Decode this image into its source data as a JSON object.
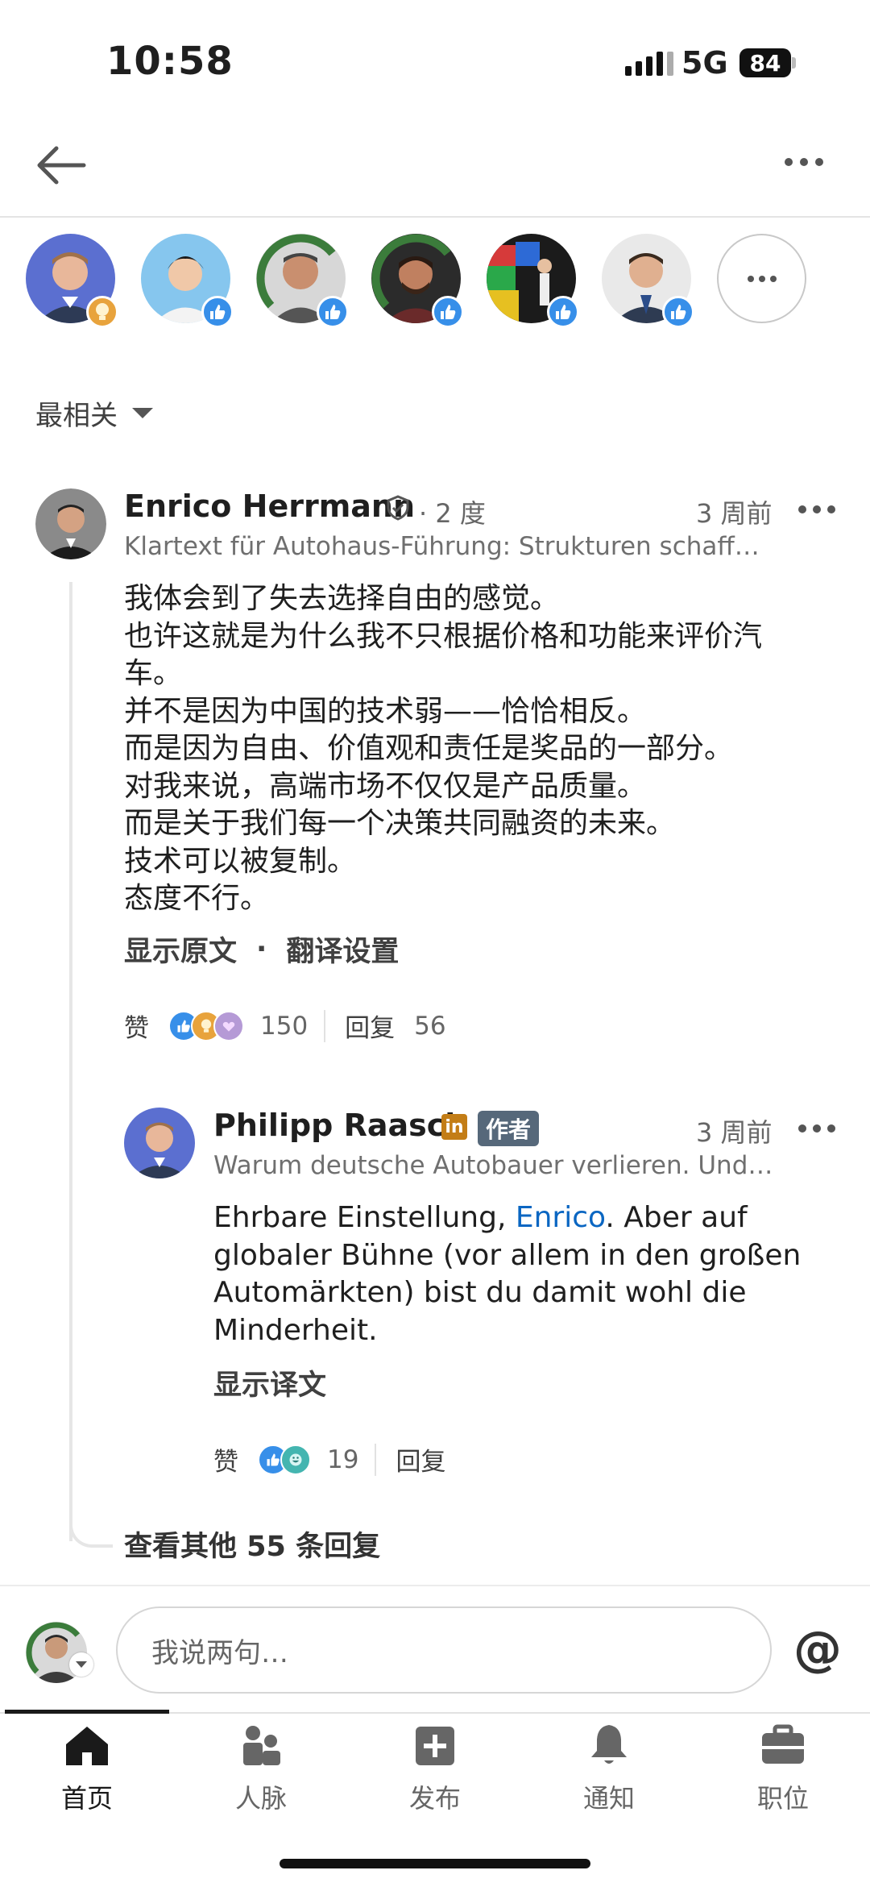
{
  "status_bar": {
    "time": "10:58",
    "network": "5G",
    "battery": "84"
  },
  "sort": {
    "label": "最相关"
  },
  "comment": {
    "author": "Enrico Herrmann",
    "degree": "· 2 度",
    "time": "3 周前",
    "headline": "Klartext für Autohaus-Führung: Strukturen schaff…",
    "lines": [
      "我体会到了失去选择自由的感觉。",
      "也许这就是为什么我不只根据价格和功能来评价汽",
      "车。",
      "并不是因为中国的技术弱——恰恰相反。",
      "而是因为自由、价值观和责任是奖品的一部分。",
      "对我来说，高端市场不仅仅是产品质量。",
      "而是关于我们每一个决策共同融资的未来。",
      "技术可以被复制。",
      "态度不行。"
    ],
    "show_original": "显示原文",
    "translate_settings": "翻译设置",
    "like_label": "赞",
    "reaction_count": "150",
    "reply_label": "回复",
    "reply_count": "56"
  },
  "reply": {
    "author": "Philipp Raasch",
    "author_tag": "作者",
    "time": "3 周前",
    "headline": "Warum deutsche Autobauer verlieren. Und…",
    "text_before": "Ehrbare Einstellung, ",
    "mention": "Enrico",
    "text_after": ". Aber auf globaler Bühne (vor allem in den großen Automärkten) bist du damit wohl die Minderheit.",
    "show_translation": "显示译文",
    "like_label": "赞",
    "reaction_count": "19",
    "reply_label": "回复"
  },
  "view_more": "查看其他 55 条回复",
  "composer": {
    "placeholder": "我说两句…",
    "at_symbol": "@"
  },
  "nav": {
    "items": [
      {
        "label": "首页",
        "icon": "home-icon"
      },
      {
        "label": "人脉",
        "icon": "people-icon"
      },
      {
        "label": "发布",
        "icon": "post-icon"
      },
      {
        "label": "通知",
        "icon": "bell-icon"
      },
      {
        "label": "职位",
        "icon": "briefcase-icon"
      }
    ],
    "active": "首页"
  },
  "colors": {
    "link": "#0a66c2",
    "like": "#378fe9",
    "insight": "#e8a33c",
    "author_tag": "#56687a"
  }
}
